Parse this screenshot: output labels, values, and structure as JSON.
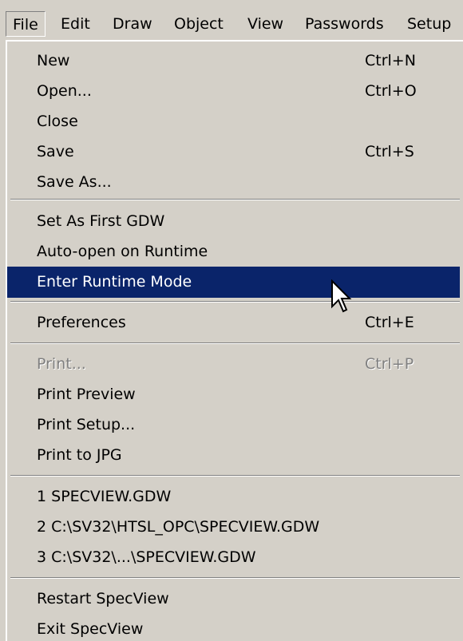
{
  "menubar": {
    "items": [
      {
        "label": "File"
      },
      {
        "label": "Edit"
      },
      {
        "label": "Draw"
      },
      {
        "label": "Object"
      },
      {
        "label": "View"
      },
      {
        "label": "Passwords"
      },
      {
        "label": "Setup"
      }
    ]
  },
  "file_menu": {
    "items": [
      {
        "label": "New",
        "shortcut": "Ctrl+N"
      },
      {
        "label": "Open...",
        "shortcut": "Ctrl+O"
      },
      {
        "label": "Close",
        "shortcut": ""
      },
      {
        "label": "Save",
        "shortcut": "Ctrl+S"
      },
      {
        "label": "Save As...",
        "shortcut": ""
      },
      {
        "label": "Set As First GDW",
        "shortcut": ""
      },
      {
        "label": "Auto-open on Runtime",
        "shortcut": ""
      },
      {
        "label": "Enter Runtime Mode",
        "shortcut": "",
        "highlighted": true
      },
      {
        "label": "Preferences",
        "shortcut": "Ctrl+E"
      },
      {
        "label": "Print...",
        "shortcut": "Ctrl+P",
        "disabled": true
      },
      {
        "label": "Print Preview",
        "shortcut": ""
      },
      {
        "label": "Print Setup...",
        "shortcut": ""
      },
      {
        "label": "Print to JPG",
        "shortcut": ""
      },
      {
        "label": "1 SPECVIEW.GDW",
        "shortcut": ""
      },
      {
        "label": "2 C:\\SV32\\HTSL_OPC\\SPECVIEW.GDW",
        "shortcut": ""
      },
      {
        "label": "3 C:\\SV32\\...\\SPECVIEW.GDW",
        "shortcut": ""
      },
      {
        "label": "Restart SpecView",
        "shortcut": ""
      },
      {
        "label": "Exit SpecView",
        "shortcut": ""
      }
    ]
  },
  "colors": {
    "menu_background": "#d4d0c8",
    "highlight_background": "#0a246a",
    "highlight_text": "#ffffff",
    "disabled_text": "#808080"
  }
}
